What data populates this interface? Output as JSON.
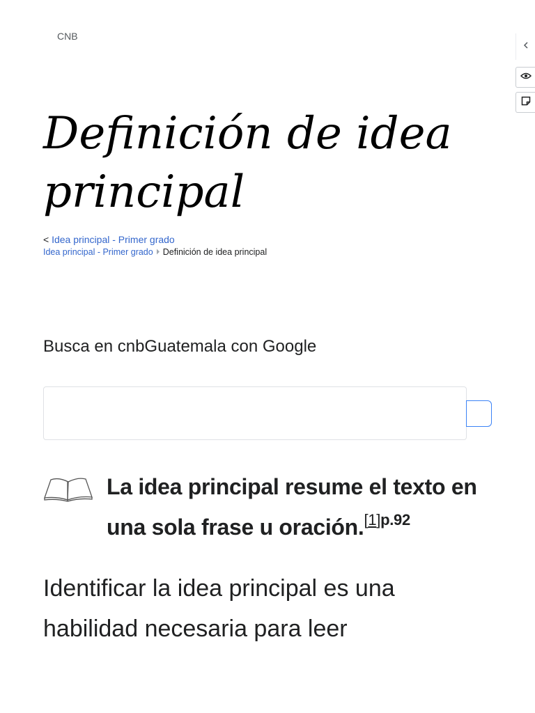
{
  "header": {
    "site_name": "CNB"
  },
  "side_tools": {
    "collapse_icon": "chevron-left-icon",
    "view_icon": "eye-icon",
    "note_icon": "note-icon"
  },
  "page": {
    "title": "Definición de idea principal"
  },
  "navigation": {
    "back_prefix": "<",
    "back_link": "Idea principal - Primer grado",
    "breadcrumb_parent": "Idea principal - Primer grado",
    "breadcrumb_current": "Definición de idea principal"
  },
  "search": {
    "label": "Busca en cnbGuatemala con Google",
    "value": "",
    "accent_color": "#3b82f6"
  },
  "callout": {
    "icon": "open-book-icon",
    "text": "La idea principal resume el texto en una sola frase u oración.",
    "ref_open": "[",
    "ref_number": "1",
    "ref_close": "]",
    "ref_page": "p.92"
  },
  "body": {
    "paragraph": "Identificar la idea principal es una habilidad necesaria para leer"
  },
  "colors": {
    "link": "#3366cc",
    "text": "#202122",
    "muted": "#54595d"
  }
}
